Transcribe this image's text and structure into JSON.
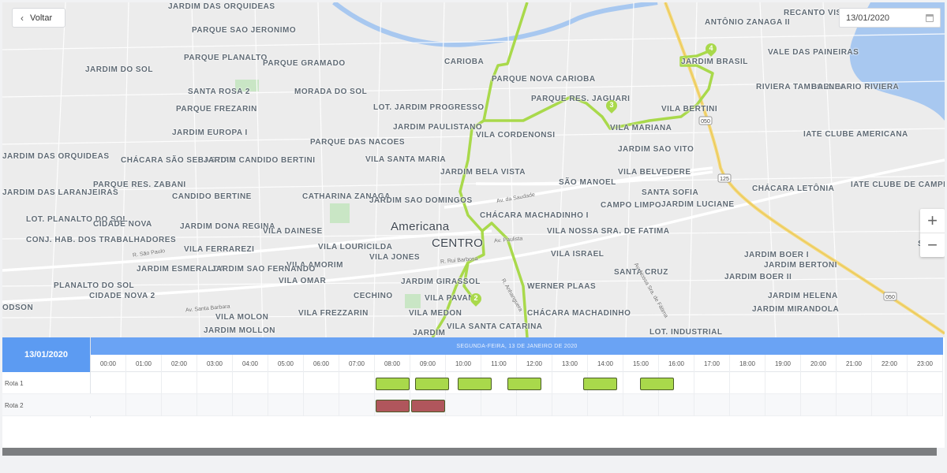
{
  "header": {
    "back_label": "Voltar",
    "date_value": "13/01/2020"
  },
  "map": {
    "city_label": "Americana",
    "center_label": "CENTRO",
    "zoom_in": "+",
    "zoom_out": "−",
    "markers": [
      "2",
      "3",
      "4"
    ],
    "route_color": "#a9d94b",
    "neighborhoods": [
      "JARDIM DAS ORQUIDEAS",
      "PARQUE SAO JERONIMO",
      "PARQUE PLANALTO",
      "PARQUE GRAMADO",
      "CARIOBA",
      "PARQUE NOVA CARIOBA",
      "RECANTO VISTA ALEGRE",
      "ANTÔNIO ZANAGA II",
      "JARDIM BRASIL",
      "VALE DAS PAINEIRAS",
      "JARDIM DO SOL",
      "SANTA ROSA 2",
      "MORADA DO SOL",
      "LOT. JARDIM PROGRESSO",
      "PARQUE RES. JAGUARI",
      "RIVIERA TAMBORLIM",
      "BALNEARIO RIVIERA",
      "PARQUE FREZARIN",
      "JARDIM EUROPA I",
      "JARDIM PAULISTANO",
      "VILA BERTINI",
      "VILA MARIANA",
      "JARDIM DAS ORQUIDEAS",
      "CHÁCARA SÃO SEBASTIAO",
      "JARDIM CANDIDO BERTINI",
      "PARQUE DAS NACOES",
      "VILA SANTA MARIA",
      "VILA CORDENONSI",
      "JARDIM SAO VITO",
      "IATE CLUBE AMERICANA",
      "PARQUE RES. ZABANI",
      "JARDIM BELA VISTA",
      "VILA BELVEDERE",
      "IATE CLUBE DE CAMPINAS",
      "JARDIM DAS LARANJEIRAS",
      "CANDIDO BERTINE",
      "CATHARINA ZANAGA",
      "JARDIM SAO DOMINGOS",
      "SÃO MANOEL",
      "SANTA SOFIA",
      "CHÁCARA LETÔNIA",
      "CHÁCARA MACHADINHO I",
      "CAMPO LIMPO",
      "JARDIM LUCIANE",
      "LOT. PLANALTO DO SOL",
      "CIDADE NOVA",
      "JARDIM DONA REGINA",
      "VILA DAINESE",
      "VILA NOSSA SRA. DE FATIMA",
      "CONJ. HAB. DOS TRABALHADORES",
      "VILA FERRAREZI",
      "VILA LOURICILDA",
      "VILA JONES",
      "VILA ISRAEL",
      "JARDIM BOER I",
      "VILA AMORIM",
      "JARDIM BERTONI",
      "JARDIM ESMERALDA",
      "JARDIM SAO FERNANDO",
      "JARDIM GIRASSOL",
      "SANTA CRUZ",
      "JARDIM BOER II",
      "PLANALTO DO SOL",
      "VILA OMAR",
      "WERNER PLAAS",
      "CIDADE NOVA 2",
      "CECHINO",
      "VILA PAVAN",
      "JARDIM HELENA",
      "ODSON",
      "VILA MOLON",
      "VILA FREZZARIN",
      "VILA MEDON",
      "CHÁCARA MACHADINHO",
      "JARDIM MIRANDOLA",
      "JARDIM MOLLON",
      "JARDIM",
      "VILA SANTA CATARINA",
      "LOT. INDUSTRIAL",
      "SAN AME"
    ],
    "streets": [
      "Av. Santa Barbara",
      "R. São Paulo",
      "R. Rui Barbosa",
      "Av. Paulista",
      "Av. da Saudade",
      "Av. Nossa Sra. de Fátima",
      "R. Anhanguera"
    ],
    "road_shields": [
      "050",
      "125",
      "050"
    ]
  },
  "timeline": {
    "date_label": "13/01/2020",
    "day_label": "SEGUNDA-FEIRA, 13 DE JANEIRO DE 2020",
    "hours": [
      "00:00",
      "01:00",
      "02:00",
      "03:00",
      "04:00",
      "05:00",
      "06:00",
      "07:00",
      "08:00",
      "09:00",
      "10:00",
      "11:00",
      "12:00",
      "13:00",
      "14:00",
      "15:00",
      "16:00",
      "17:00",
      "18:00",
      "19:00",
      "20:00",
      "21:00",
      "22:00",
      "23:00"
    ],
    "rows": [
      {
        "label": "Rota 1",
        "color": "#a9d94b",
        "segments": [
          [
            8.0,
            9.0
          ],
          [
            9.1,
            10.1
          ],
          [
            10.3,
            11.3
          ],
          [
            11.7,
            12.7
          ],
          [
            13.85,
            14.85
          ],
          [
            15.45,
            16.45
          ]
        ]
      },
      {
        "label": "Rota 2",
        "color": "#b0565c",
        "segments": [
          [
            8.0,
            9.0
          ],
          [
            9.0,
            10.0
          ]
        ]
      }
    ]
  }
}
